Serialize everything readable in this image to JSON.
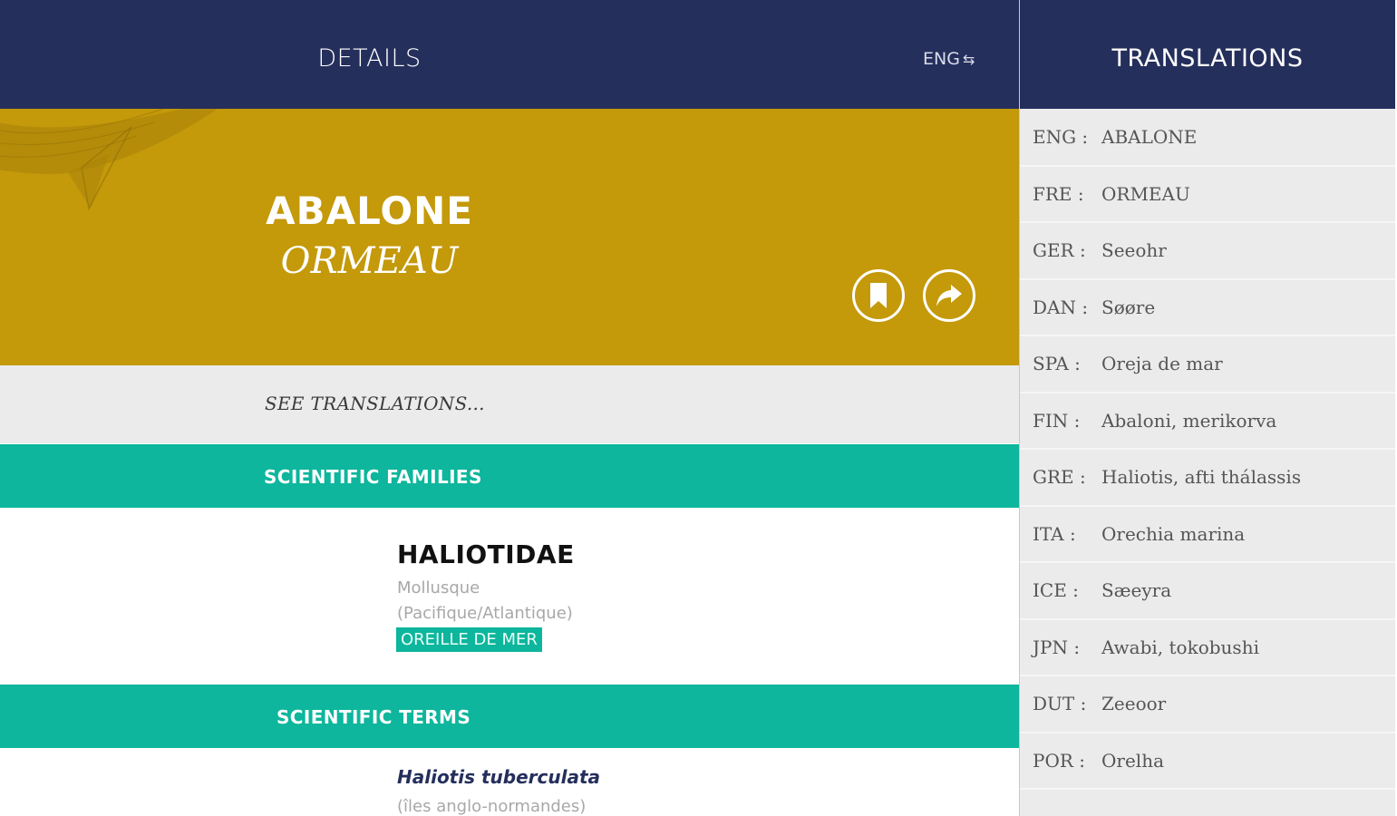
{
  "details_panel": {
    "header": {
      "title": "DETAILS",
      "language_toggle": "ENG",
      "swap_icon": "swap-arrows-icon"
    },
    "hero": {
      "name": "ABALONE",
      "subname": "ORMEAU",
      "background_color": "#c4990a",
      "bookmark_icon": "bookmark-icon",
      "share_icon": "share-arrow-icon"
    },
    "see_translations": "SEE TRANSLATIONS...",
    "scientific_families": {
      "heading": "SCIENTIFIC FAMILIES",
      "name": "HALIOTIDAE",
      "type": "Mollusque",
      "region": "(Pacifique/Atlantique)",
      "tag": "OREILLE DE MER"
    },
    "scientific_terms": {
      "heading": "SCIENTIFIC TERMS",
      "term": "Haliotis tuberculata",
      "region": "(îles anglo-normandes)"
    }
  },
  "translations_panel": {
    "title": "TRANSLATIONS",
    "items": [
      {
        "code": "ENG :",
        "value": "ABALONE"
      },
      {
        "code": "FRE :",
        "value": "ORMEAU"
      },
      {
        "code": "GER :",
        "value": "Seeohr"
      },
      {
        "code": "DAN :",
        "value": "Søøre"
      },
      {
        "code": "SPA :",
        "value": "Oreja de mar"
      },
      {
        "code": "FIN :",
        "value": "Abaloni, merikorva"
      },
      {
        "code": "GRE :",
        "value": "Haliotis, afti thálassis"
      },
      {
        "code": "ITA :",
        "value": "Orechia marina"
      },
      {
        "code": "ICE :",
        "value": "Sæeyra"
      },
      {
        "code": "JPN :",
        "value": "Awabi, tokobushi"
      },
      {
        "code": "DUT :",
        "value": "Zeeoor"
      },
      {
        "code": "POR :",
        "value": "Orelha"
      }
    ]
  },
  "colors": {
    "header": "#252f5c",
    "accent_gold": "#c4990a",
    "accent_teal": "#0db69c",
    "panel_grey": "#ebebeb"
  }
}
